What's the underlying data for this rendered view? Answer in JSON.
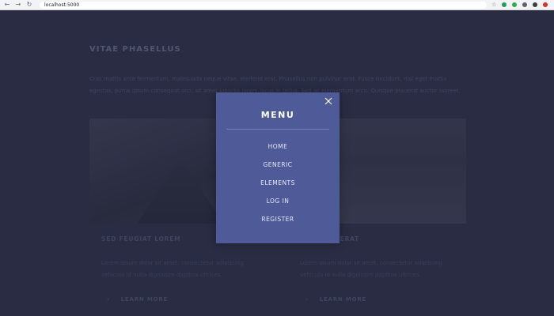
{
  "browser": {
    "url": "localhost:5000",
    "back_icon": "arrow-left-icon",
    "forward_icon": "arrow-right-icon",
    "reload_icon": "reload-icon",
    "extension_colors": [
      "#1aa260",
      "#34a853",
      "#5f6368",
      "#3c4043",
      "#d93025"
    ]
  },
  "page": {
    "title": "VITAE PHASELLUS",
    "intro": "Cras mattis ante fermentum, malesuada neque vitae, eleifend erat. Phasellus non pulvinar erat. Fusce tincidunt, nisl eget mattis egestas, purus ipsum consequat orci, sit amet lobortis lorem lacus in tellus. Sed ac elementum arcu. Quisque placerat auctor laoreet.",
    "cards": [
      {
        "title": "SED FEUGIAT LOREM",
        "text": "Lorem ipsum dolor sit amet, consectetur adipiscing vehicula id nulla dignissim dapibus ultrices.",
        "link": "LEARN MORE"
      },
      {
        "title": "NISL PLACERAT",
        "text": "Lorem ipsum dolor sit amet, consectetur adipiscing vehicula id nulla dignissim dapibus ultrices.",
        "link": "LEARN MORE"
      }
    ]
  },
  "menu": {
    "title": "MENU",
    "close_icon": "close-icon",
    "background": "#4f5b98",
    "items": [
      {
        "label": "HOME"
      },
      {
        "label": "GENERIC"
      },
      {
        "label": "ELEMENTS"
      },
      {
        "label": "LOG IN"
      },
      {
        "label": "REGISTER"
      }
    ]
  }
}
